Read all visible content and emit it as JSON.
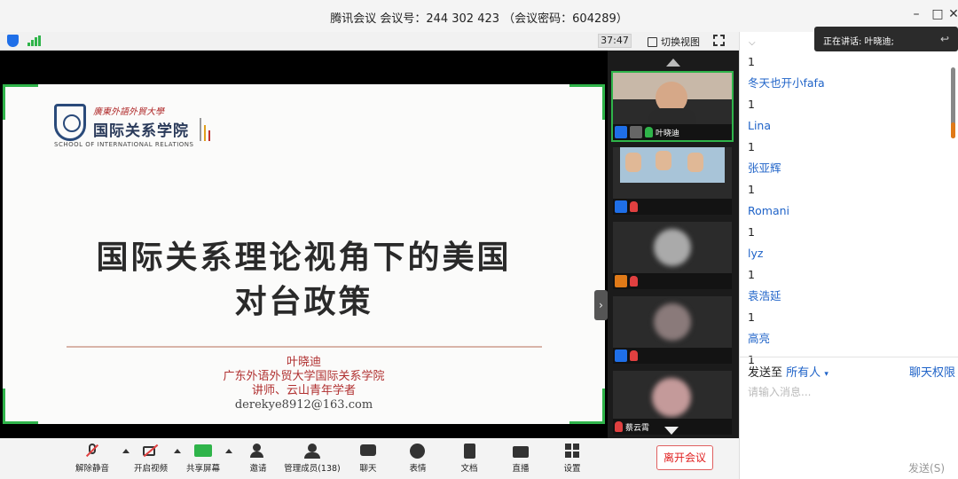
{
  "window": {
    "title": "腾讯会议 会议号：244 302 423 （会议密码：604289）"
  },
  "meeting_bar": {
    "timer": "37:47",
    "switch_view": "切换视图"
  },
  "slide": {
    "univ_name": "廣東外語外貿大學",
    "school_name": "国际关系学院",
    "school_english": "SCHOOL OF INTERNATIONAL RELATIONS",
    "title_line1": "国际关系理论视角下的美国",
    "title_line2": "对台政策",
    "presenter": "叶晓迪",
    "affiliation": "广东外语外贸大学国际关系学院",
    "position": "讲师、云山青年学者",
    "email": "derekye8912@163.com"
  },
  "participants": [
    {
      "name": "叶晓迪",
      "active": true
    },
    {
      "name": "",
      "active": false
    },
    {
      "name": "",
      "active": false
    },
    {
      "name": "",
      "active": false
    },
    {
      "name": "蔡云霄",
      "active": false
    }
  ],
  "speaking_banner": "正在讲话: 叶晓迪;",
  "chat": {
    "messages": [
      {
        "type": "text",
        "value": "1"
      },
      {
        "type": "name",
        "value": "冬天也开小fafa"
      },
      {
        "type": "text",
        "value": "1"
      },
      {
        "type": "name",
        "value": "Lina"
      },
      {
        "type": "text",
        "value": "1"
      },
      {
        "type": "name",
        "value": "张亚辉"
      },
      {
        "type": "text",
        "value": "1"
      },
      {
        "type": "name",
        "value": "Romani"
      },
      {
        "type": "text",
        "value": "1"
      },
      {
        "type": "name",
        "value": "lyz"
      },
      {
        "type": "text",
        "value": "1"
      },
      {
        "type": "name",
        "value": "袁浩延"
      },
      {
        "type": "text",
        "value": "1"
      },
      {
        "type": "name",
        "value": "高亮"
      },
      {
        "type": "text",
        "value": "1"
      }
    ],
    "send_to_label": "发送至",
    "send_to_value": "所有人",
    "permissions": "聊天权限",
    "input_placeholder": "请输入消息...",
    "send_button": "发送(S)"
  },
  "toolbar": {
    "unmute": "解除静音",
    "start_video": "开启视频",
    "share_screen": "共享屏幕",
    "invite": "邀请",
    "manage_members": "管理成员(138)",
    "chat": "聊天",
    "reactions": "表情",
    "documents": "文档",
    "live": "直播",
    "settings": "设置",
    "leave": "离开会议"
  },
  "colors": {
    "accent_green": "#2fb44a",
    "link_blue": "#1f63c8",
    "leave_red": "#e02020"
  }
}
